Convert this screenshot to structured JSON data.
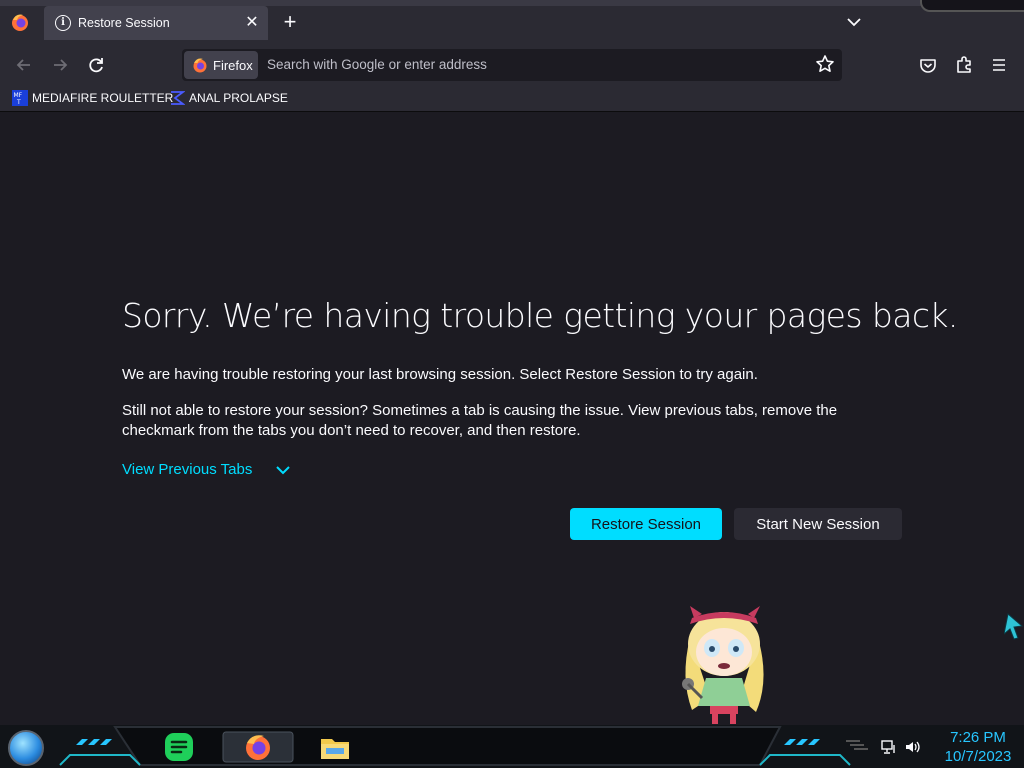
{
  "browser": {
    "tab": {
      "title": "Restore Session",
      "close_icon": "close-icon",
      "info_icon": "info-icon"
    },
    "new_tab_label": "+",
    "identity_label": "Firefox",
    "url_placeholder": "Search with Google or enter address"
  },
  "bookmarks": [
    {
      "label": "MEDIAFIRE ROULETTER",
      "icon": "mediafire-icon"
    },
    {
      "label": "ANAL PROLAPSE",
      "icon": "bookmark-icon"
    }
  ],
  "page": {
    "heading": "Sorry. We’re having trouble getting your pages back.",
    "paragraph1": "We are having trouble restoring your last browsing session. Select Restore Session to try again.",
    "paragraph2": "Still not able to restore your session? Sometimes a tab is causing the issue. View previous tabs, remove the checkmark from the tabs you don’t need to recover, and then restore.",
    "view_previous_tabs": "View Previous Tabs",
    "restore_button": "Restore Session",
    "new_session_button": "Start New Session"
  },
  "taskbar": {
    "time": "7:26 PM",
    "date": "10/7/2023",
    "apps": [
      "start-orb",
      "notes-app-icon",
      "firefox-icon",
      "file-explorer-icon"
    ]
  },
  "colors": {
    "accent": "#00ddff",
    "background": "#1c1b22",
    "toolbar": "#2b2a33",
    "clock": "#27c6ff"
  }
}
